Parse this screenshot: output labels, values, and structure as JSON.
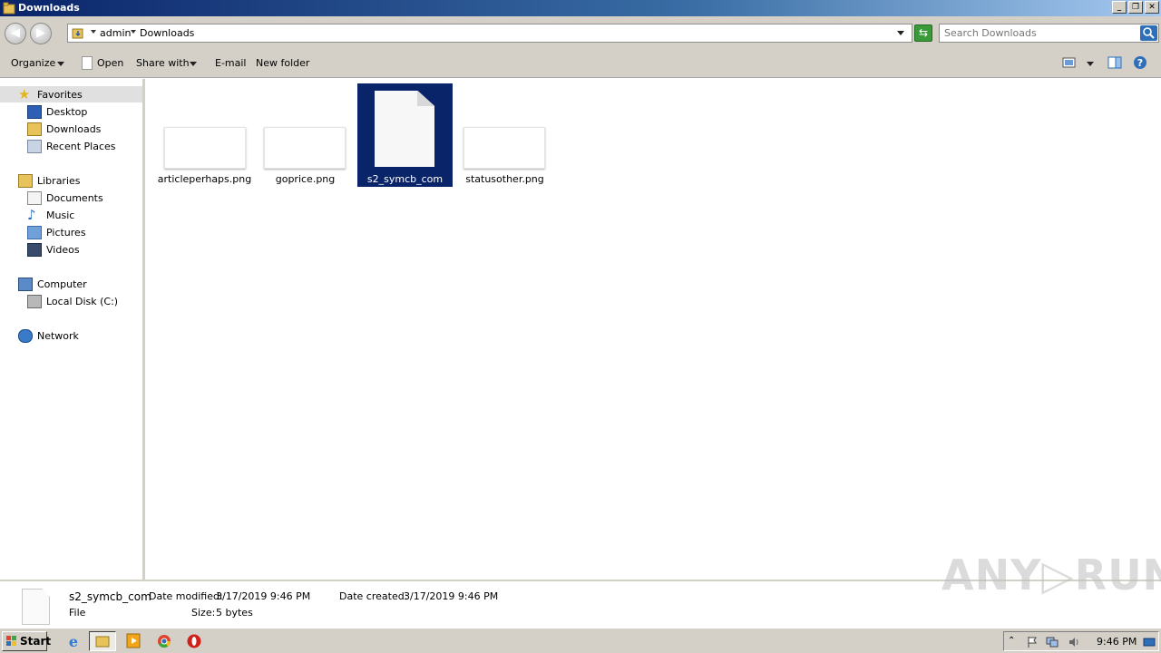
{
  "window": {
    "title": "Downloads",
    "buttons": [
      "_",
      "❐",
      "✕"
    ]
  },
  "address": {
    "crumbs": [
      "admin",
      "Downloads"
    ],
    "search_placeholder": "Search Downloads"
  },
  "toolbar": {
    "organize": "Organize",
    "open": "Open",
    "share_with": "Share with",
    "email": "E-mail",
    "new_folder": "New folder"
  },
  "nav": {
    "favorites": "Favorites",
    "desktop": "Desktop",
    "downloads": "Downloads",
    "recent": "Recent Places",
    "libraries": "Libraries",
    "documents": "Documents",
    "music": "Music",
    "pictures": "Pictures",
    "videos": "Videos",
    "computer": "Computer",
    "local_disk": "Local Disk (C:)",
    "network": "Network"
  },
  "files": [
    {
      "name": "articleperhaps.png",
      "selected": false
    },
    {
      "name": "goprice.png",
      "selected": false
    },
    {
      "name": "s2_symcb_com",
      "selected": true
    },
    {
      "name": "statusother.png",
      "selected": false
    }
  ],
  "details": {
    "name": "s2_symcb_com",
    "type": "File",
    "modified_label": "Date modified:",
    "modified_value": "3/17/2019 9:46 PM",
    "created_label": "Date created:",
    "created_value": "3/17/2019 9:46 PM",
    "size_label": "Size:",
    "size_value": "5 bytes"
  },
  "watermark": "ANY▷RUN",
  "taskbar": {
    "start": "Start",
    "clock": "9:46 PM"
  },
  "colors": {
    "selection": "#0a246a",
    "chrome": "#d4d0c8"
  }
}
